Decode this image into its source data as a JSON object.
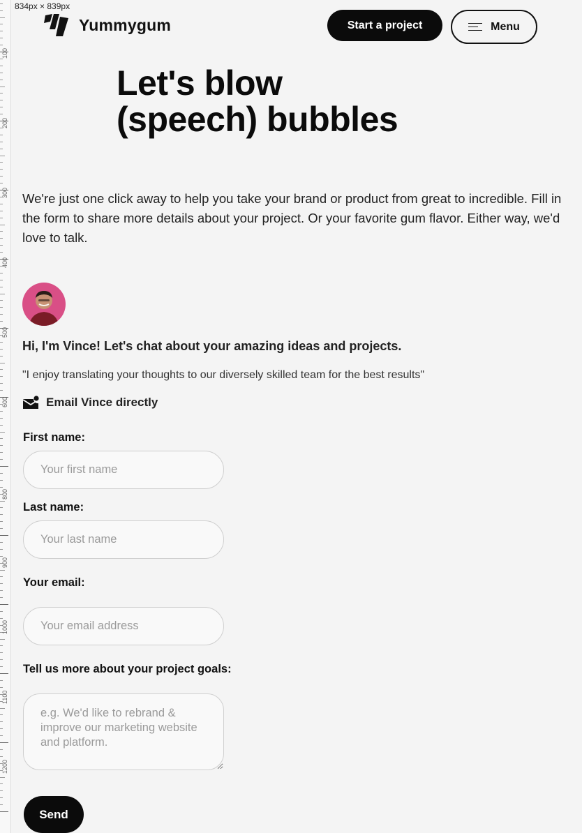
{
  "devtools": {
    "size_label": "834px × 839px",
    "ruler_labels": [
      "100",
      "200",
      "300",
      "400",
      "500",
      "600",
      "800",
      "900",
      "1000",
      "1100",
      "1200"
    ]
  },
  "header": {
    "brand": "Yummygum",
    "cta_label": "Start a project",
    "menu_label": "Menu"
  },
  "hero": {
    "line1": "Let's blow",
    "line2": "(speech) bubbles"
  },
  "intro": "We're just one click away to help you take your brand or product from great to incredible. Fill in the form to share more details about your project. Or your favorite gum flavor. Either way, we'd love to talk.",
  "contact": {
    "greeting": "Hi, I'm Vince! Let's chat about your amazing ideas and projects.",
    "quote": "\"I enjoy translating your thoughts to our diversely skilled team for the best results\"",
    "email_label": "Email Vince directly"
  },
  "form": {
    "first_name": {
      "label": "First name:",
      "placeholder": "Your first name",
      "value": ""
    },
    "last_name": {
      "label": "Last name:",
      "placeholder": "Your last name",
      "value": ""
    },
    "email": {
      "label": "Your email:",
      "placeholder": "Your email address",
      "value": ""
    },
    "goals": {
      "label": "Tell us more about your project goals:",
      "placeholder": "e.g. We'd like to rebrand & improve our marketing website and platform.",
      "value": ""
    },
    "submit_label": "Send"
  },
  "colors": {
    "background": "#f4f4f4",
    "primary": "#0b0b0b",
    "avatar_bg": "#d94f86",
    "placeholder": "#9a9a9a"
  },
  "icons": {
    "logo": "yummygum-logo-icon",
    "menu": "hamburger-icon",
    "email": "mail-notification-icon"
  }
}
